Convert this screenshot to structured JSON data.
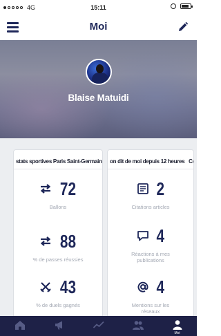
{
  "status_bar": {
    "carrier": "4G",
    "time": "15:11"
  },
  "nav": {
    "title": "Moi",
    "menu_icon": "menu-icon",
    "edit_icon": "pencil-icon"
  },
  "profile": {
    "name": "Blaise Matuidi",
    "avatar_icon": "avatar"
  },
  "cards": [
    {
      "title": "stats sportives Paris Saint-Germain",
      "stats": [
        {
          "icon": "passes-arrows-icon",
          "value": "72",
          "label": "Ballons"
        },
        {
          "icon": "passes-arrows-icon",
          "value": "88",
          "label": "% de passes réussies"
        },
        {
          "icon": "crossed-swords-icon",
          "value": "43",
          "label": "% de duels gagnés"
        }
      ]
    },
    {
      "title": "on dit de moi depuis 12 heures",
      "title_overflow": "Ce",
      "stats": [
        {
          "icon": "newspaper-icon",
          "value": "2",
          "label": "Citations articles"
        },
        {
          "icon": "comment-icon",
          "value": "4",
          "label": "Réactions à mes publications"
        },
        {
          "icon": "at-sign-icon",
          "value": "4",
          "label": "Mentions sur les réseaux"
        }
      ]
    }
  ],
  "tabs": [
    {
      "icon": "home-icon",
      "label": ""
    },
    {
      "icon": "megaphone-icon",
      "label": ""
    },
    {
      "icon": "chart-icon",
      "label": ""
    },
    {
      "icon": "group-icon",
      "label": ""
    },
    {
      "icon": "user-icon",
      "label": "Moi",
      "active": true
    }
  ],
  "colors": {
    "primary": "#1e2759",
    "tab_bar": "#1e2147",
    "muted": "#a3a8b3"
  }
}
